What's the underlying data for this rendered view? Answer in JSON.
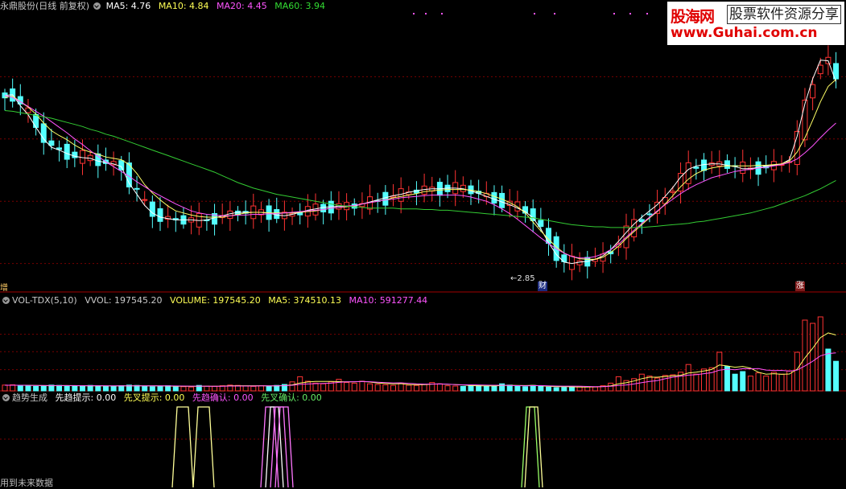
{
  "price_panel": {
    "title": "永鼎股份(日线 前复权)",
    "ma5": "MA5: 4.76",
    "ma10": "MA10: 4.84",
    "ma20": "MA20: 4.45",
    "ma60": "MA60: 3.94",
    "low_marker": "2.85",
    "left_tag": "增",
    "tag_cai": "财",
    "tag_zhang": "涨"
  },
  "volume_panel": {
    "name": "VOL-TDX(5,10)",
    "vvol": "VVOL: 197545.20",
    "volume": "VOLUME: 197545.20",
    "ma5": "MA5: 374510.13",
    "ma10": "MA10: 591277.44"
  },
  "signal_panel": {
    "name": "趋势生成",
    "label1": "先趋提示: 0.00",
    "label2": "先叉提示: 0.00",
    "label3": "先趋确认: 0.00",
    "label4": "先叉确认: 0.00",
    "footnote": "用到未来数据"
  },
  "logo": {
    "line1a": "股海网",
    "line1b": "股票软件资源分享",
    "line2": "www.Guhai.com.cn"
  },
  "colors": {
    "up": "#ff3333",
    "down": "#54ffff",
    "ma5": "#ffffff",
    "ma10": "#ffff66",
    "ma20": "#ff55ff",
    "ma60": "#33cc33",
    "grid": "#7a0000"
  },
  "chart_data": [
    {
      "type": "candlestick",
      "title": "永鼎股份(日线 前复权)",
      "ylim": [
        2.6,
        6.6
      ],
      "gridlines": [
        3.0,
        3.9,
        4.8,
        5.7
      ],
      "low_annotation": 2.85,
      "series": [
        {
          "name": "MA5",
          "values": [
            5.43,
            5.44,
            5.28,
            5.15,
            4.97,
            4.8,
            4.68,
            4.64,
            4.59,
            4.55,
            4.53,
            4.52,
            4.48,
            4.46,
            4.44,
            4.4,
            4.16,
            4.0,
            3.84,
            3.73,
            3.67,
            3.65,
            3.63,
            3.63,
            3.63,
            3.62,
            3.63,
            3.66,
            3.69,
            3.72,
            3.74,
            3.74,
            3.74,
            3.74,
            3.73,
            3.7,
            3.69,
            3.71,
            3.74,
            3.77,
            3.79,
            3.81,
            3.82,
            3.83,
            3.83,
            3.83,
            3.86,
            3.89,
            3.92,
            3.95,
            3.98,
            4.0,
            4.03,
            4.05,
            4.07,
            4.08,
            4.08,
            4.09,
            4.09,
            4.08,
            4.05,
            4.01,
            3.97,
            3.93,
            3.89,
            3.85,
            3.8,
            3.75,
            3.66,
            3.5,
            3.3,
            3.13,
            3.02,
            3.0,
            3.02,
            3.03,
            3.06,
            3.11,
            3.2,
            3.32,
            3.45,
            3.57,
            3.67,
            3.76,
            3.85,
            3.97,
            4.1,
            4.25,
            4.36,
            4.41,
            4.43,
            4.44,
            4.44,
            4.42,
            4.4,
            4.37,
            4.37,
            4.39,
            4.41,
            4.42,
            4.44,
            4.5,
            4.84,
            5.31,
            5.67,
            5.94,
            5.93,
            5.63
          ]
        },
        {
          "name": "MA10",
          "values": [
            5.4,
            5.42,
            5.34,
            5.26,
            5.16,
            5.03,
            4.92,
            4.85,
            4.79,
            4.71,
            4.65,
            4.61,
            4.58,
            4.54,
            4.52,
            4.5,
            4.43,
            4.3,
            4.14,
            4.02,
            3.92,
            3.83,
            3.76,
            3.73,
            3.7,
            3.68,
            3.67,
            3.67,
            3.67,
            3.69,
            3.71,
            3.73,
            3.74,
            3.74,
            3.73,
            3.73,
            3.73,
            3.73,
            3.74,
            3.75,
            3.76,
            3.78,
            3.8,
            3.81,
            3.82,
            3.84,
            3.86,
            3.88,
            3.9,
            3.92,
            3.95,
            3.97,
            3.99,
            4.01,
            4.04,
            4.05,
            4.06,
            4.07,
            4.07,
            4.07,
            4.06,
            4.04,
            4.01,
            3.97,
            3.93,
            3.88,
            3.82,
            3.73,
            3.6,
            3.47,
            3.35,
            3.24,
            3.15,
            3.1,
            3.07,
            3.06,
            3.06,
            3.09,
            3.16,
            3.25,
            3.36,
            3.46,
            3.56,
            3.66,
            3.75,
            3.86,
            3.98,
            4.11,
            4.22,
            4.3,
            4.35,
            4.38,
            4.4,
            4.41,
            4.41,
            4.41,
            4.41,
            4.42,
            4.42,
            4.43,
            4.44,
            4.48,
            4.61,
            4.82,
            5.07,
            5.34,
            5.56,
            5.66
          ]
        },
        {
          "name": "MA20",
          "values": [
            5.43,
            5.4,
            5.34,
            5.27,
            5.2,
            5.13,
            5.05,
            4.97,
            4.89,
            4.8,
            4.72,
            4.63,
            4.55,
            4.47,
            4.4,
            4.33,
            4.26,
            4.18,
            4.11,
            4.04,
            3.98,
            3.92,
            3.86,
            3.81,
            3.76,
            3.73,
            3.71,
            3.7,
            3.69,
            3.69,
            3.7,
            3.7,
            3.71,
            3.71,
            3.72,
            3.72,
            3.73,
            3.74,
            3.75,
            3.76,
            3.77,
            3.78,
            3.8,
            3.81,
            3.83,
            3.84,
            3.86,
            3.88,
            3.9,
            3.92,
            3.93,
            3.95,
            3.96,
            3.97,
            3.98,
            3.99,
            3.99,
            3.99,
            3.99,
            3.98,
            3.96,
            3.93,
            3.9,
            3.85,
            3.79,
            3.72,
            3.64,
            3.55,
            3.46,
            3.37,
            3.29,
            3.21,
            3.15,
            3.1,
            3.08,
            3.08,
            3.1,
            3.14,
            3.2,
            3.28,
            3.38,
            3.48,
            3.58,
            3.67,
            3.76,
            3.85,
            3.93,
            4.01,
            4.08,
            4.14,
            4.19,
            4.24,
            4.27,
            4.3,
            4.33,
            4.35,
            4.36,
            4.38,
            4.39,
            4.41,
            4.43,
            4.46,
            4.51,
            4.6,
            4.7,
            4.82,
            4.93,
            5.03
          ]
        },
        {
          "name": "MA60",
          "values": [
            5.21,
            5.2,
            5.18,
            5.16,
            5.14,
            5.12,
            5.1,
            5.07,
            5.04,
            5.01,
            4.98,
            4.94,
            4.91,
            4.87,
            4.84,
            4.8,
            4.76,
            4.72,
            4.68,
            4.64,
            4.6,
            4.56,
            4.52,
            4.48,
            4.44,
            4.4,
            4.36,
            4.32,
            4.27,
            4.22,
            4.17,
            4.13,
            4.09,
            4.06,
            4.03,
            4.0,
            3.98,
            3.96,
            3.94,
            3.92,
            3.9,
            3.88,
            3.86,
            3.84,
            3.83,
            3.82,
            3.81,
            3.8,
            3.8,
            3.8,
            3.8,
            3.79,
            3.79,
            3.79,
            3.78,
            3.78,
            3.77,
            3.77,
            3.76,
            3.75,
            3.74,
            3.73,
            3.72,
            3.71,
            3.7,
            3.69,
            3.68,
            3.67,
            3.66,
            3.64,
            3.62,
            3.6,
            3.58,
            3.56,
            3.55,
            3.54,
            3.53,
            3.53,
            3.52,
            3.52,
            3.52,
            3.52,
            3.52,
            3.53,
            3.54,
            3.55,
            3.56,
            3.57,
            3.58,
            3.6,
            3.61,
            3.63,
            3.65,
            3.67,
            3.69,
            3.71,
            3.73,
            3.76,
            3.79,
            3.82,
            3.86,
            3.9,
            3.94,
            3.98,
            4.03,
            4.08,
            4.14,
            4.2
          ]
        }
      ]
    },
    {
      "type": "bar",
      "title": "VOL-TDX(5,10)",
      "ylim": [
        0,
        1300000
      ],
      "gridlines": [
        330000,
        610000,
        880000
      ],
      "values": [
        90000,
        95000,
        80000,
        85000,
        70000,
        75000,
        90000,
        85000,
        80000,
        70000,
        75000,
        85000,
        80000,
        75000,
        70000,
        80000,
        90000,
        85000,
        70000,
        65000,
        75000,
        80000,
        70000,
        65000,
        60000,
        85000,
        75000,
        70000,
        80000,
        90000,
        85000,
        75000,
        70000,
        80000,
        75000,
        85000,
        100000,
        140000,
        220000,
        150000,
        120000,
        110000,
        140000,
        180000,
        130000,
        120000,
        150000,
        110000,
        100000,
        95000,
        85000,
        120000,
        90000,
        85000,
        100000,
        130000,
        110000,
        80000,
        75000,
        70000,
        80000,
        85000,
        75000,
        70000,
        110000,
        90000,
        75000,
        65000,
        85000,
        70000,
        60000,
        50000,
        55000,
        60000,
        70000,
        65000,
        60000,
        80000,
        120000,
        220000,
        160000,
        190000,
        260000,
        230000,
        200000,
        240000,
        250000,
        290000,
        410000,
        260000,
        340000,
        360000,
        600000,
        380000,
        260000,
        300000,
        230000,
        280000,
        230000,
        290000,
        260000,
        310000,
        600000,
        1100000,
        1050000,
        1150000,
        650000,
        460000
      ],
      "series": [
        {
          "name": "MA5",
          "values": [
            88000,
            88000,
            87000,
            86000,
            84000,
            81000,
            80000,
            81000,
            82000,
            80000,
            80000,
            79000,
            78000,
            77000,
            76000,
            78000,
            79000,
            80000,
            79000,
            78000,
            77000,
            75000,
            72000,
            71000,
            70000,
            71000,
            71000,
            71000,
            74000,
            80000,
            80000,
            80000,
            80000,
            80000,
            77000,
            78000,
            83000,
            94000,
            123000,
            139000,
            146000,
            148000,
            148000,
            144000,
            140000,
            141000,
            146000,
            138000,
            122000,
            115000,
            108000,
            112000,
            98000,
            96000,
            96000,
            105000,
            107000,
            101000,
            99000,
            93000,
            83000,
            78000,
            77000,
            76000,
            84000,
            86000,
            84000,
            82000,
            86000,
            79000,
            71000,
            66000,
            67000,
            63000,
            59000,
            60000,
            62000,
            67000,
            79000,
            109000,
            126000,
            154000,
            190000,
            212000,
            212000,
            224000,
            234000,
            242000,
            278000,
            290000,
            310000,
            332000,
            402000,
            388000,
            368000,
            380000,
            354000,
            290000,
            260000,
            268000,
            258000,
            262000,
            338000,
            514000,
            662000,
            829000,
            901000,
            869000
          ]
        },
        {
          "name": "MA10",
          "values": [
            88000,
            88000,
            87000,
            86000,
            85000,
            84000,
            83000,
            83000,
            83000,
            82000,
            80000,
            80000,
            80000,
            79000,
            78000,
            78000,
            78000,
            79000,
            78000,
            77000,
            77000,
            77000,
            76000,
            75000,
            74000,
            74000,
            73000,
            72000,
            72000,
            75000,
            75000,
            75000,
            75000,
            77000,
            78000,
            79000,
            81000,
            87000,
            101000,
            108000,
            112000,
            115000,
            120000,
            133000,
            140000,
            143000,
            147000,
            143000,
            134000,
            128000,
            124000,
            125000,
            118000,
            109000,
            105000,
            106000,
            107000,
            105000,
            98000,
            94000,
            94000,
            92000,
            89000,
            87000,
            88000,
            84000,
            81000,
            79000,
            81000,
            82000,
            78000,
            75000,
            74000,
            74000,
            72000,
            69000,
            66000,
            66000,
            71000,
            84000,
            92000,
            107000,
            128000,
            146000,
            160000,
            189000,
            212000,
            227000,
            245000,
            251000,
            267000,
            283000,
            322000,
            338000,
            329000,
            345000,
            343000,
            346000,
            324000,
            318000,
            319000,
            308000,
            322000,
            389000,
            460000,
            545000,
            580000,
            591000
          ]
        }
      ]
    }
  ]
}
